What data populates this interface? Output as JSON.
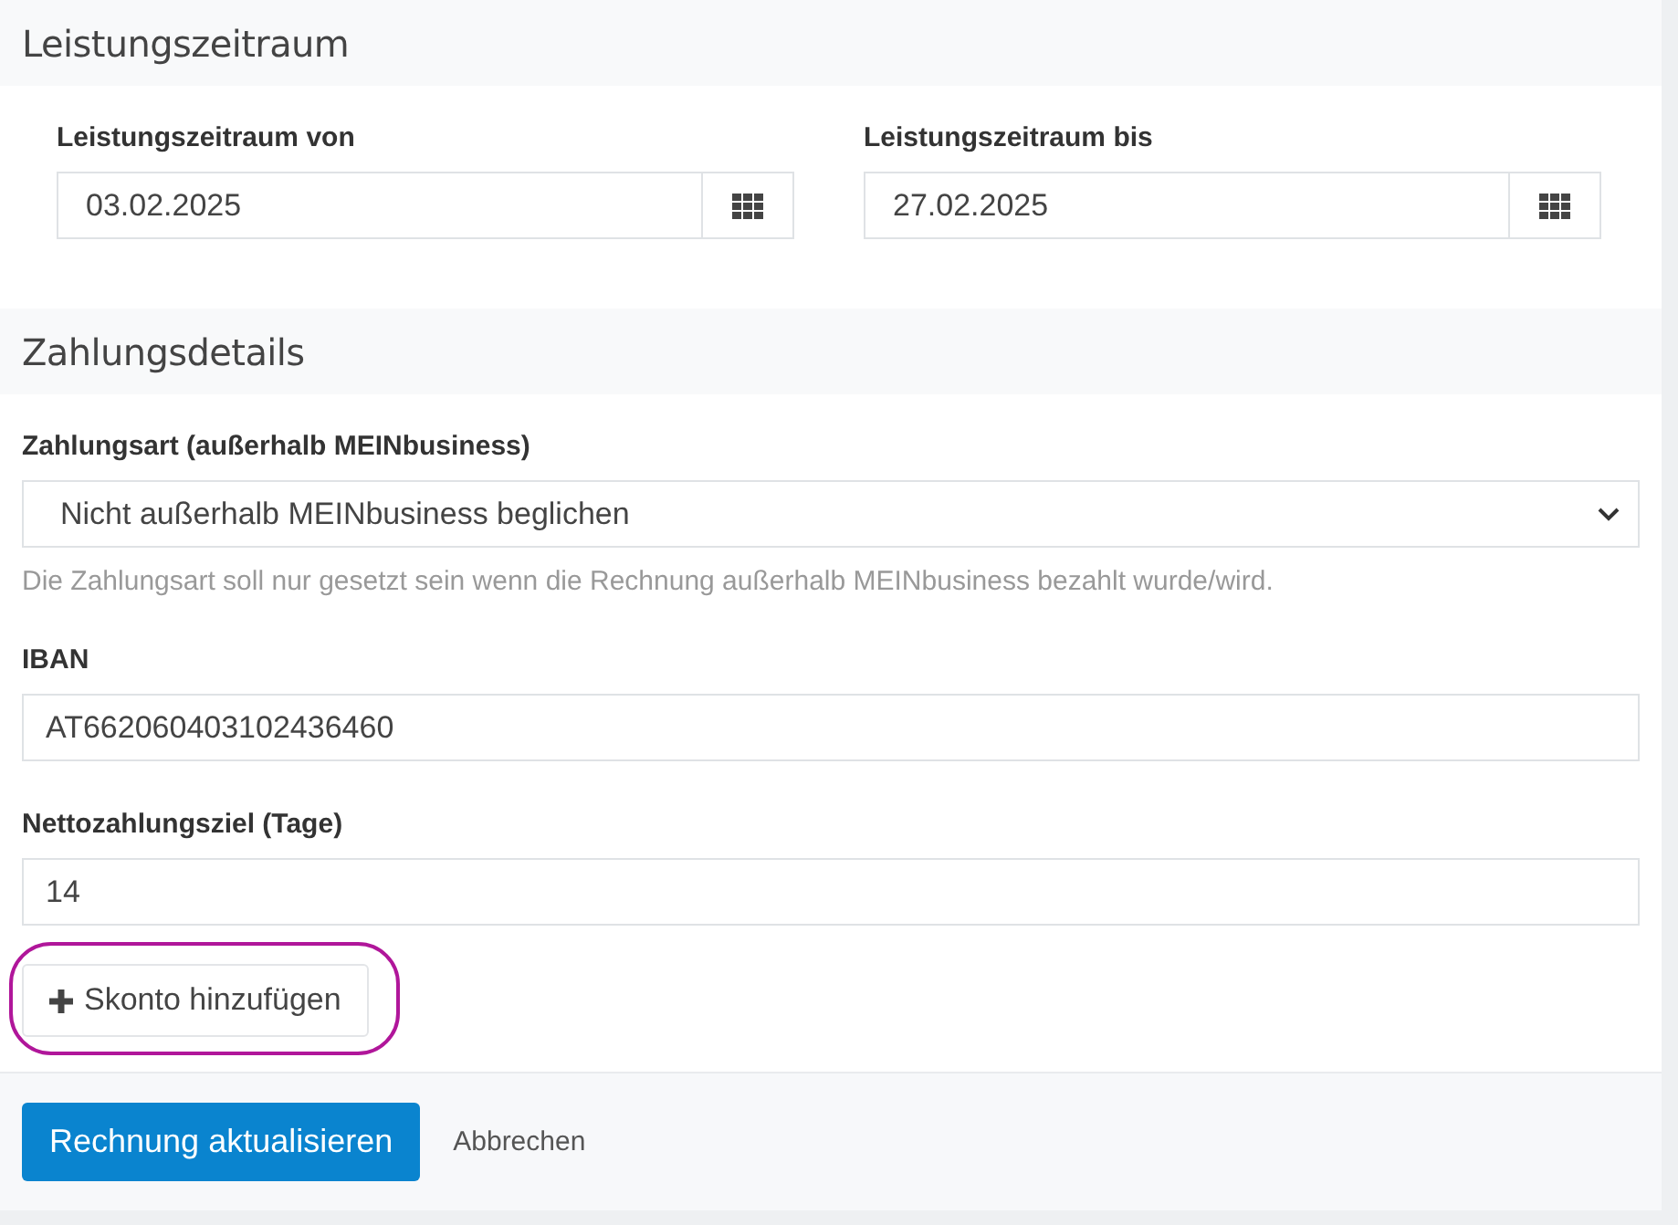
{
  "sections": [
    {
      "title": "Leistungszeitraum",
      "kind": "dates",
      "fields": [
        {
          "label": "Leistungszeitraum von",
          "value": "03.02.2025"
        },
        {
          "label": "Leistungszeitraum bis",
          "value": "27.02.2025"
        }
      ]
    },
    {
      "title": "Zahlungsdetails",
      "kind": "payment",
      "payment_method": {
        "label": "Zahlungsart (außerhalb MEINbusiness)",
        "value": "Nicht außerhalb MEINbusiness beglichen",
        "hint": "Die Zahlungsart soll nur gesetzt sein wenn die Rechnung außerhalb MEINbusiness bezahlt wurde/wird."
      },
      "fields": [
        {
          "label": "IBAN",
          "value": "AT662060403102436460"
        },
        {
          "label": "Nettozahlungsziel (Tage)",
          "value": "14"
        }
      ],
      "add_button": {
        "label": "Skonto hinzufügen",
        "highlighted": true
      }
    }
  ],
  "footer": {
    "primary": "Rechnung aktualisieren",
    "cancel": "Abbrechen"
  }
}
